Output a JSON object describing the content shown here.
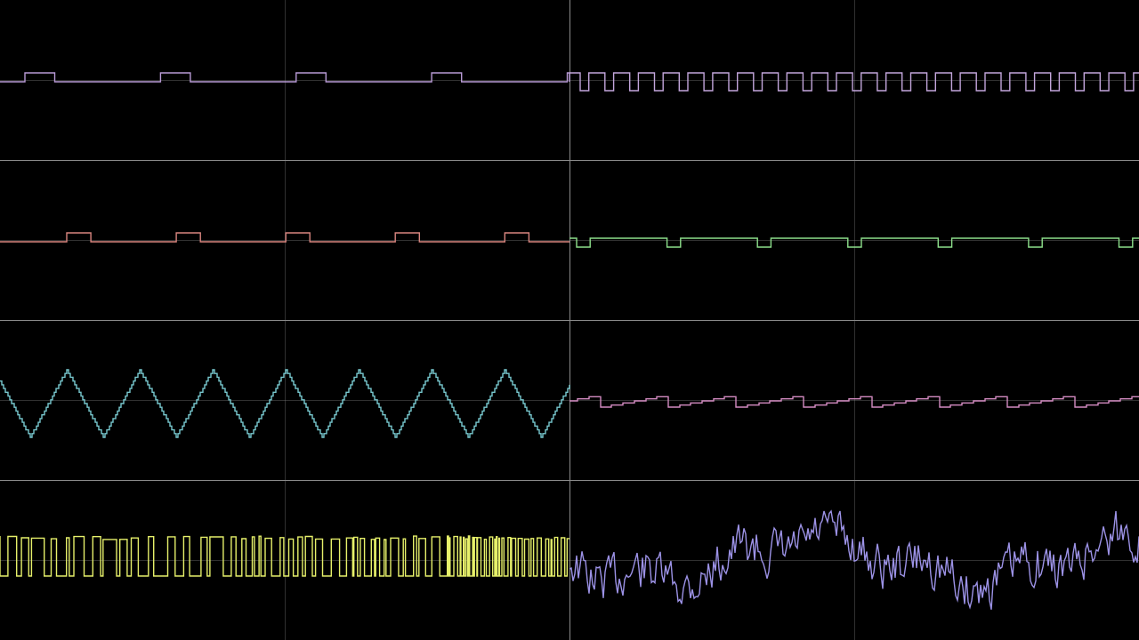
{
  "background": "#000000",
  "grid_color": "#8a8a8a",
  "channels": [
    {
      "id": "ch-1-left",
      "row": 0,
      "side": "left",
      "color": "#b89ad6",
      "waveform": "pulse-narrow-high",
      "cycles": 4.2
    },
    {
      "id": "ch-1-right",
      "row": 0,
      "side": "right",
      "color": "#c3a6dc",
      "waveform": "pulse-low-dips",
      "cycles": 23
    },
    {
      "id": "ch-2-left",
      "row": 1,
      "side": "left",
      "color": "#d9857f",
      "waveform": "pulse-narrow-high",
      "cycles": 5.2
    },
    {
      "id": "ch-2-right",
      "row": 1,
      "side": "right",
      "color": "#8ee08c",
      "waveform": "pulse-low-dips",
      "cycles": 6.3
    },
    {
      "id": "ch-3-left",
      "row": 2,
      "side": "left",
      "color": "#78c9cf",
      "waveform": "stepped-triangle",
      "cycles": 7.8
    },
    {
      "id": "ch-3-right",
      "row": 2,
      "side": "right",
      "color": "#d48cc2",
      "waveform": "stepped-sawtooth",
      "cycles": 8.4
    },
    {
      "id": "ch-4-left",
      "row": 3,
      "side": "left",
      "color": "#e6f06a",
      "waveform": "noise-pulse",
      "cycles": 0
    },
    {
      "id": "ch-4-right",
      "row": 3,
      "side": "right",
      "color": "#9c92e6",
      "waveform": "sample-noise",
      "cycles": 0
    }
  ]
}
